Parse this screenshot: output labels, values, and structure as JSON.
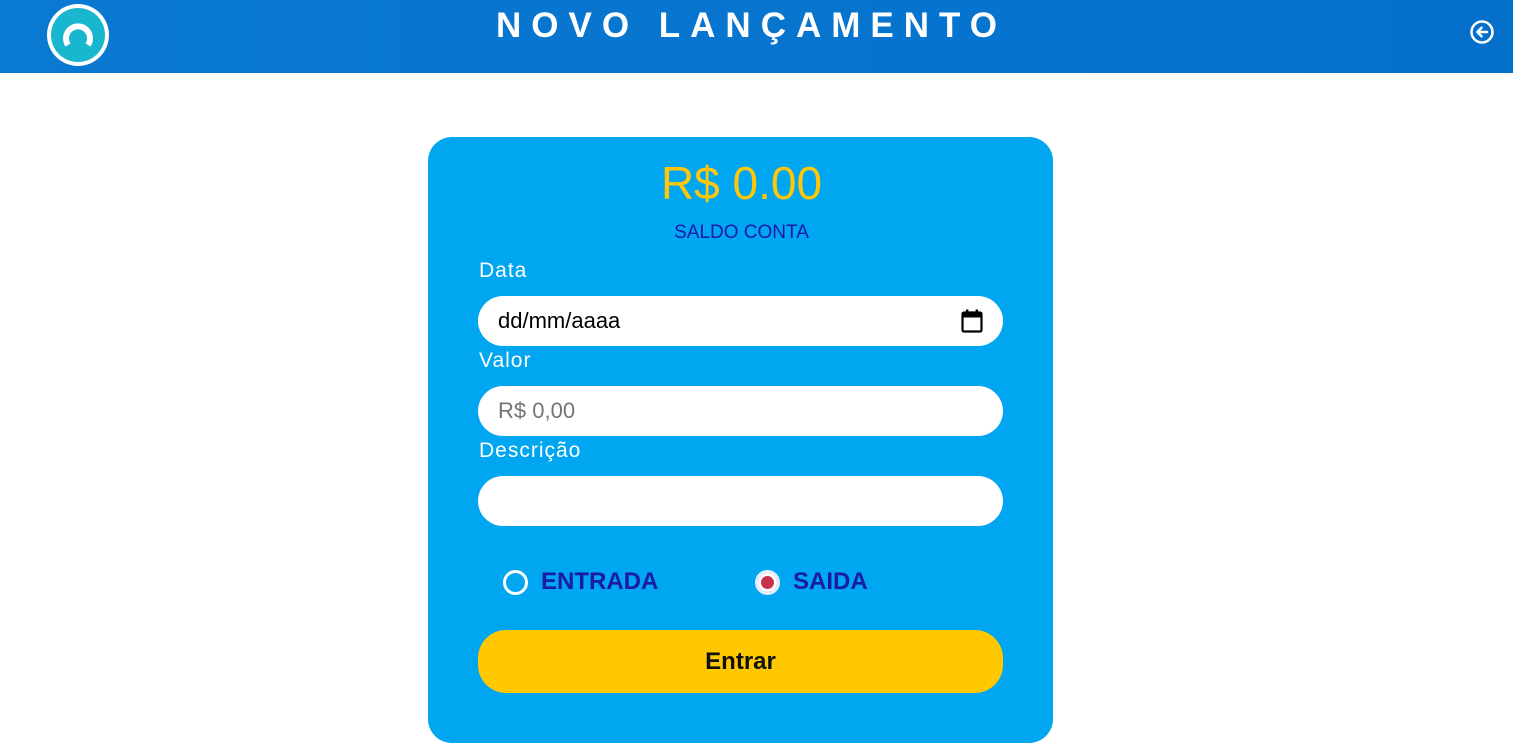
{
  "header": {
    "title": "NOVO LANÇAMENTO",
    "logo_icon": "logo-icon",
    "logout_icon": "back-arrow-circle-icon",
    "background": "#0470cc"
  },
  "summary": {
    "balance": "R$ 0.00",
    "balance_label": "SALDO CONTA",
    "balance_color": "#ffc60a"
  },
  "form": {
    "date": {
      "label": "Data",
      "value": "dd/mm/aaaa",
      "icon": "calendar-icon"
    },
    "amount": {
      "label": "Valor",
      "placeholder": "R$ 0,00",
      "value": ""
    },
    "description": {
      "label": "Descrição",
      "value": ""
    },
    "type": {
      "options": [
        {
          "label": "ENTRADA",
          "checked": false
        },
        {
          "label": "SAIDA",
          "checked": true
        }
      ]
    },
    "submit_label": "Entrar",
    "card_color": "#00a6f0",
    "button_color": "#ffc800"
  }
}
